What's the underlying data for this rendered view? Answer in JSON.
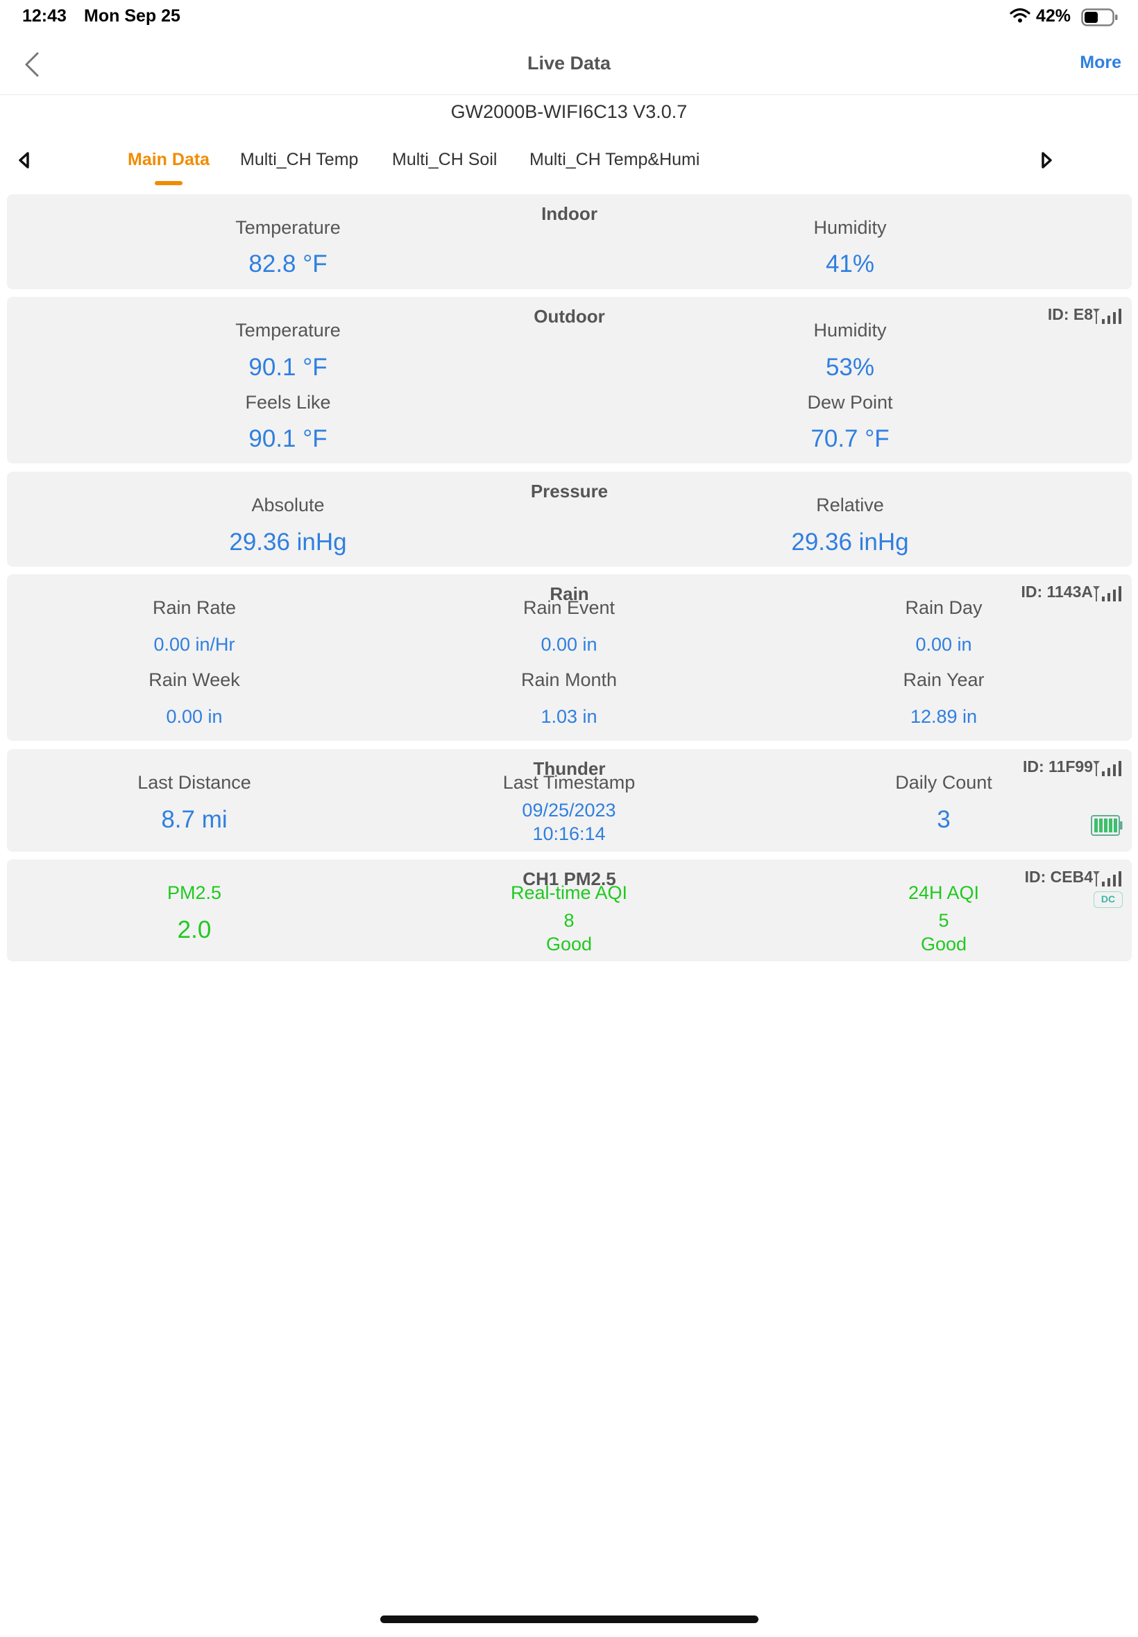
{
  "status": {
    "time": "12:43",
    "date": "Mon Sep 25",
    "battery": "42%"
  },
  "nav": {
    "title": "Live Data",
    "more": "More"
  },
  "device": "GW2000B-WIFI6C13 V3.0.7",
  "tabs": [
    "Main Data",
    "Multi_CH Temp",
    "Multi_CH Soil",
    "Multi_CH Temp&Humi"
  ],
  "colors": {
    "accent": "#f08c00",
    "value": "#2f7fe0",
    "aqi_good": "#1fc91f",
    "card_bg": "#f2f2f2"
  },
  "icons": [
    "back-chevron-icon",
    "tab-left-arrow-icon",
    "tab-right-arrow-icon",
    "wifi-icon",
    "battery-icon",
    "signal-icon",
    "sensor-battery-full-icon",
    "dc-power-icon"
  ],
  "indoor": {
    "title": "Indoor",
    "temp_label": "Temperature",
    "temp": "82.8 °F",
    "hum_label": "Humidity",
    "hum": "41%"
  },
  "outdoor": {
    "title": "Outdoor",
    "id": "ID: E8",
    "temp_label": "Temperature",
    "temp": "90.1 °F",
    "hum_label": "Humidity",
    "hum": "53%",
    "feels_label": "Feels Like",
    "feels": "90.1 °F",
    "dew_label": "Dew Point",
    "dew": "70.7 °F"
  },
  "pressure": {
    "title": "Pressure",
    "abs_label": "Absolute",
    "abs": "29.36 inHg",
    "rel_label": "Relative",
    "rel": "29.36 inHg"
  },
  "rain": {
    "title": "Rain",
    "id": "ID: 1143A",
    "rate_label": "Rain Rate",
    "rate": "0.00 in/Hr",
    "event_label": "Rain Event",
    "event": "0.00 in",
    "day_label": "Rain Day",
    "day": "0.00 in",
    "week_label": "Rain Week",
    "week": "0.00 in",
    "month_label": "Rain Month",
    "month": "1.03 in",
    "year_label": "Rain Year",
    "year": "12.89 in"
  },
  "thunder": {
    "title": "Thunder",
    "id": "ID: 11F99",
    "dist_label": "Last Distance",
    "dist": "8.7 mi",
    "ts_label": "Last Timestamp",
    "ts_date": "09/25/2023",
    "ts_time": "10:16:14",
    "count_label": "Daily Count",
    "count": "3"
  },
  "pm25": {
    "title": "CH1 PM2.5",
    "id": "ID: CEB4",
    "dc": "DC",
    "pm_label": "PM2.5",
    "pm": "2.0",
    "rt_label": "Real-time AQI",
    "rt_val": "8",
    "rt_status": "Good",
    "h24_label": "24H AQI",
    "h24_val": "5",
    "h24_status": "Good"
  }
}
